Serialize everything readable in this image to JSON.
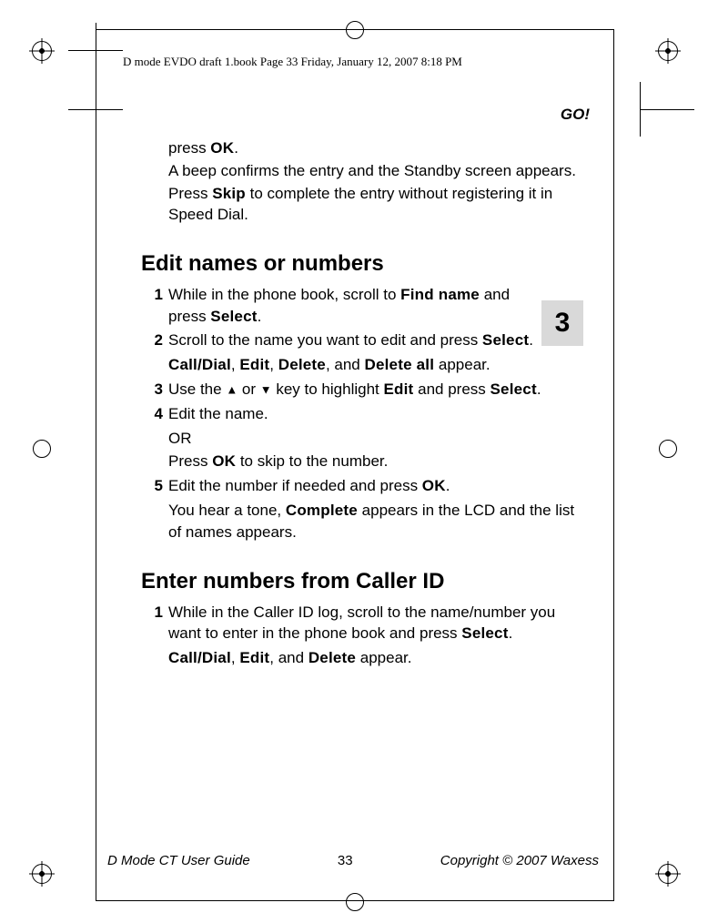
{
  "header": {
    "draft_line": "D mode EVDO draft 1.book  Page 33  Friday, January 12, 2007  8:18 PM",
    "running_head": "GO!"
  },
  "tab_number": "3",
  "intro": {
    "line1_a": "press ",
    "line1_b": "OK",
    "line1_c": ".",
    "line2": "A beep confirms the entry and the Standby screen appears.",
    "line3_a": "Press ",
    "line3_b": "Skip",
    "line3_c": " to complete the entry without registering it in Speed Dial."
  },
  "section1": {
    "title": "Edit names or numbers",
    "steps": [
      {
        "n": "1",
        "t_a": "While in the phone book, scroll to ",
        "t_b": "Find name",
        "t_c": " and press ",
        "t_d": "Select",
        "t_e": "."
      },
      {
        "n": "2",
        "t_a": "Scroll to the name you want to edit and press ",
        "t_b": "Select",
        "t_c": ".",
        "sub_a": "Call/Dial",
        "sub_b": ", ",
        "sub_c": "Edit",
        "sub_d": ", ",
        "sub_e": "Delete",
        "sub_f": ", and ",
        "sub_g": "Delete all",
        "sub_h": " appear."
      },
      {
        "n": "3",
        "t_a": "Use the ",
        "t_b": " or ",
        "t_c": " key to highlight ",
        "t_d": "Edit",
        "t_e": " and press ",
        "t_f": "Select",
        "t_g": "."
      },
      {
        "n": "4",
        "t_a": "Edit the name.",
        "sub1": "OR",
        "sub2_a": "Press ",
        "sub2_b": "OK",
        "sub2_c": " to skip to the number."
      },
      {
        "n": "5",
        "t_a": "Edit the number if needed and press ",
        "t_b": "OK",
        "t_c": ".",
        "sub_a": "You hear a tone, ",
        "sub_b": "Complete",
        "sub_c": " appears in the LCD and the list of names appears."
      }
    ]
  },
  "section2": {
    "title": "Enter numbers from Caller ID",
    "steps": [
      {
        "n": "1",
        "t_a": "While in the Caller ID log, scroll to the name/number you want to enter in the phone book and press ",
        "t_b": "Select",
        "t_c": ".",
        "sub_a": "Call/Dial",
        "sub_b": ", ",
        "sub_c": "Edit",
        "sub_d": ", and ",
        "sub_e": "Delete",
        "sub_f": " appear."
      }
    ]
  },
  "footer": {
    "left": "D Mode CT User Guide",
    "page": "33",
    "right": "Copyright © 2007 Waxess"
  },
  "icons": {
    "up": "▲",
    "down": "▼"
  }
}
